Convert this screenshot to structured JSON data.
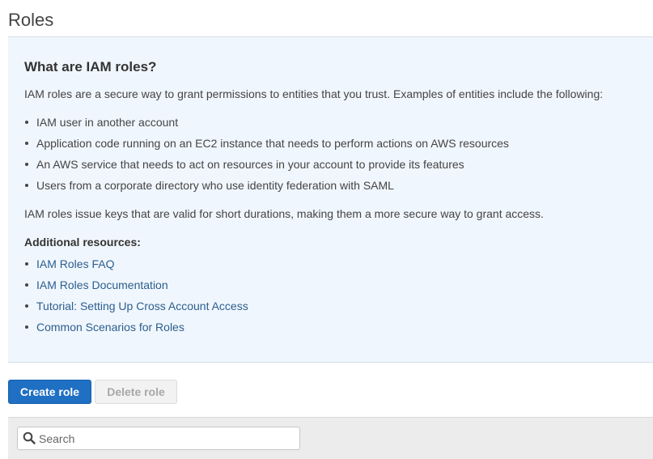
{
  "page": {
    "title": "Roles"
  },
  "info": {
    "heading": "What are IAM roles?",
    "intro": "IAM roles are a secure way to grant permissions to entities that you trust. Examples of entities include the following:",
    "bullets": [
      "IAM user in another account",
      "Application code running on an EC2 instance that needs to perform actions on AWS resources",
      "An AWS service that needs to act on resources in your account to provide its features",
      "Users from a corporate directory who use identity federation with SAML"
    ],
    "summary": "IAM roles issue keys that are valid for short durations, making them a more secure way to grant access.",
    "resources_heading": "Additional resources:",
    "resources": [
      "IAM Roles FAQ",
      "IAM Roles Documentation",
      "Tutorial: Setting Up Cross Account Access",
      "Common Scenarios for Roles"
    ]
  },
  "toolbar": {
    "create_label": "Create role",
    "delete_label": "Delete role"
  },
  "search": {
    "placeholder": "Search",
    "value": "",
    "icon": "search-icon"
  },
  "colors": {
    "primary_button": "#1f6fc3",
    "info_panel_bg": "#f0f6fd",
    "link": "#2b5e8e"
  }
}
